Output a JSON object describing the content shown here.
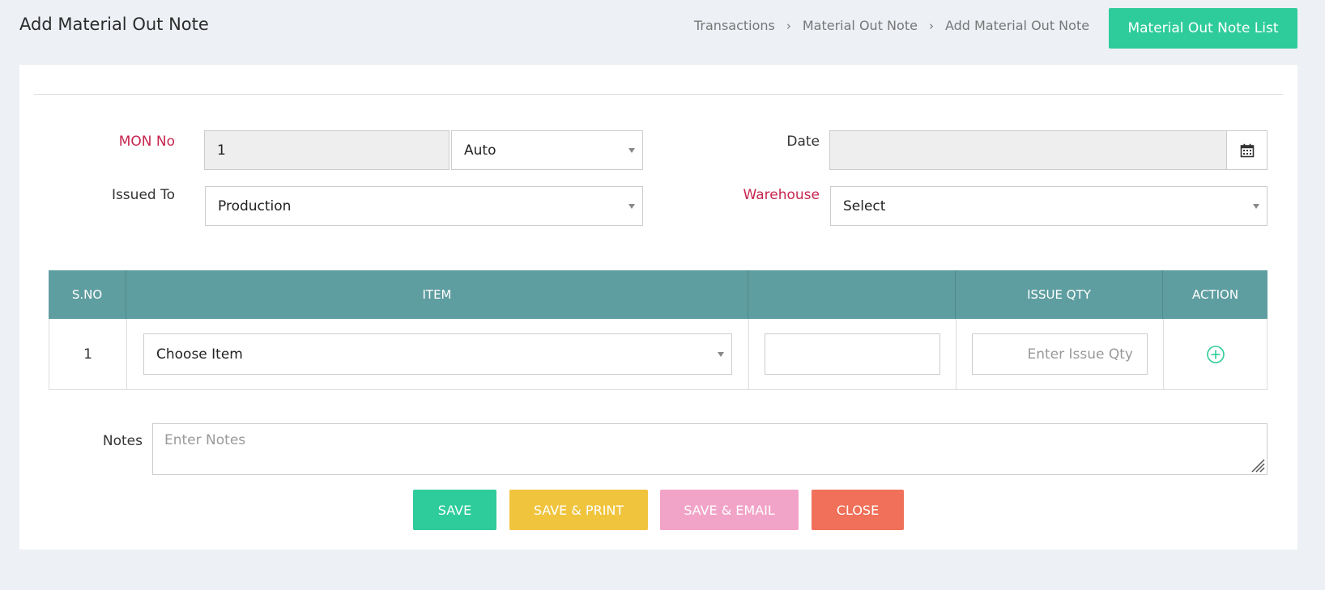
{
  "header": {
    "title": "Add Material Out Note",
    "breadcrumb": [
      "Transactions",
      "Material Out Note",
      "Add Material Out Note"
    ],
    "list_button": "Material Out Note List"
  },
  "form": {
    "mon_no": {
      "label": "MON No",
      "value": "1",
      "mode": "Auto"
    },
    "date": {
      "label": "Date",
      "value": ""
    },
    "issued_to": {
      "label": "Issued To",
      "value": "Production"
    },
    "warehouse": {
      "label": "Warehouse",
      "value": "Select"
    }
  },
  "table": {
    "headers": [
      "S.NO",
      "ITEM",
      "",
      "ISSUE QTY",
      "ACTION"
    ],
    "rows": [
      {
        "sno": "1",
        "item": "Choose Item",
        "extra": "",
        "qty_placeholder": "Enter Issue Qty"
      }
    ]
  },
  "notes": {
    "label": "Notes",
    "placeholder": "Enter Notes"
  },
  "buttons": {
    "save": "SAVE",
    "save_print": "SAVE & PRINT",
    "save_email": "SAVE & EMAIL",
    "close": "CLOSE"
  },
  "colors": {
    "accent": "#2ecc9a",
    "table_header": "#5f9ea0",
    "required": "#c7254e",
    "save_print": "#f0c43d",
    "save_email": "#f2a3c8",
    "close": "#f07059"
  }
}
